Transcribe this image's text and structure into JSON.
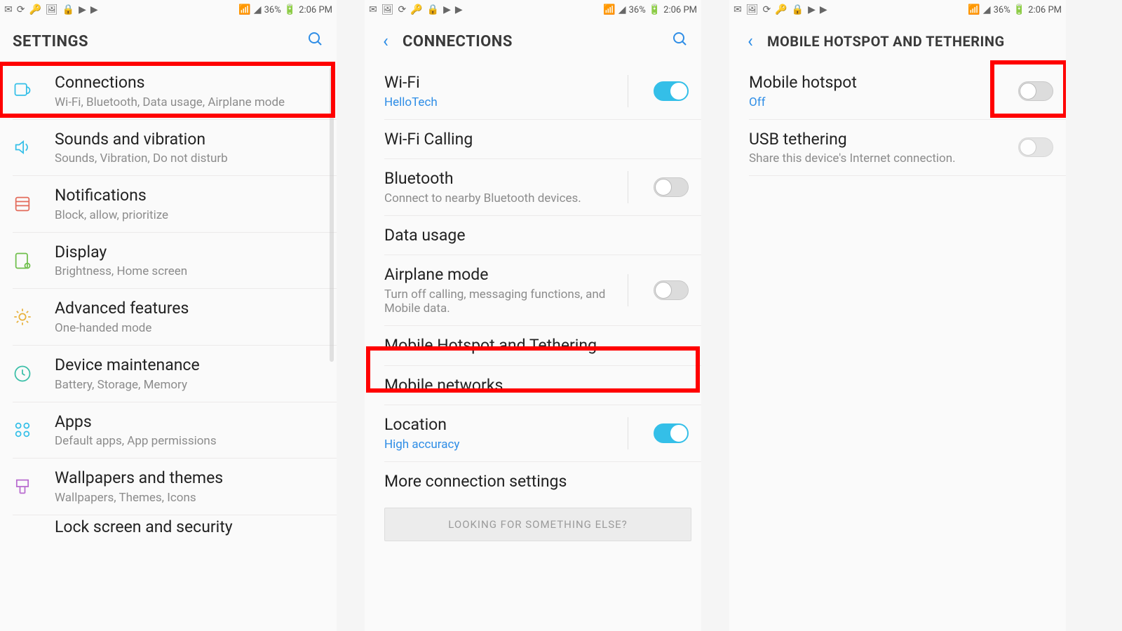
{
  "statusbar": {
    "battery_text": "36%",
    "time": "2:06 PM"
  },
  "screen1": {
    "title": "SETTINGS",
    "items": [
      {
        "title": "Connections",
        "sub": "Wi-Fi, Bluetooth, Data usage, Airplane mode"
      },
      {
        "title": "Sounds and vibration",
        "sub": "Sounds, Vibration, Do not disturb"
      },
      {
        "title": "Notifications",
        "sub": "Block, allow, prioritize"
      },
      {
        "title": "Display",
        "sub": "Brightness, Home screen"
      },
      {
        "title": "Advanced features",
        "sub": "One-handed mode"
      },
      {
        "title": "Device maintenance",
        "sub": "Battery, Storage, Memory"
      },
      {
        "title": "Apps",
        "sub": "Default apps, App permissions"
      },
      {
        "title": "Wallpapers and themes",
        "sub": "Wallpapers, Themes, Icons"
      },
      {
        "title": "Lock screen and security",
        "sub": ""
      }
    ]
  },
  "screen2": {
    "title": "CONNECTIONS",
    "items": [
      {
        "title": "Wi-Fi",
        "sub": "HelloTech",
        "sub_accent": true,
        "toggle": "on"
      },
      {
        "title": "Wi-Fi Calling",
        "sub": "",
        "toggle": null
      },
      {
        "title": "Bluetooth",
        "sub": "Connect to nearby Bluetooth devices.",
        "toggle": "off"
      },
      {
        "title": "Data usage",
        "sub": "",
        "toggle": null
      },
      {
        "title": "Airplane mode",
        "sub": "Turn off calling, messaging functions, and Mobile data.",
        "toggle": "off"
      },
      {
        "title": "Mobile Hotspot and Tethering",
        "sub": "",
        "toggle": null
      },
      {
        "title": "Mobile networks",
        "sub": "",
        "toggle": null
      },
      {
        "title": "Location",
        "sub": "High accuracy",
        "sub_accent": true,
        "toggle": "on"
      },
      {
        "title": "More connection settings",
        "sub": "",
        "toggle": null
      }
    ],
    "footer_card": "LOOKING FOR SOMETHING ELSE?"
  },
  "screen3": {
    "title": "MOBILE HOTSPOT AND TETHERING",
    "items": [
      {
        "title": "Mobile hotspot",
        "sub": "Off",
        "sub_accent": true,
        "toggle": "off"
      },
      {
        "title": "USB tethering",
        "sub": "Share this device's Internet connection.",
        "toggle": "off-dim"
      }
    ]
  }
}
